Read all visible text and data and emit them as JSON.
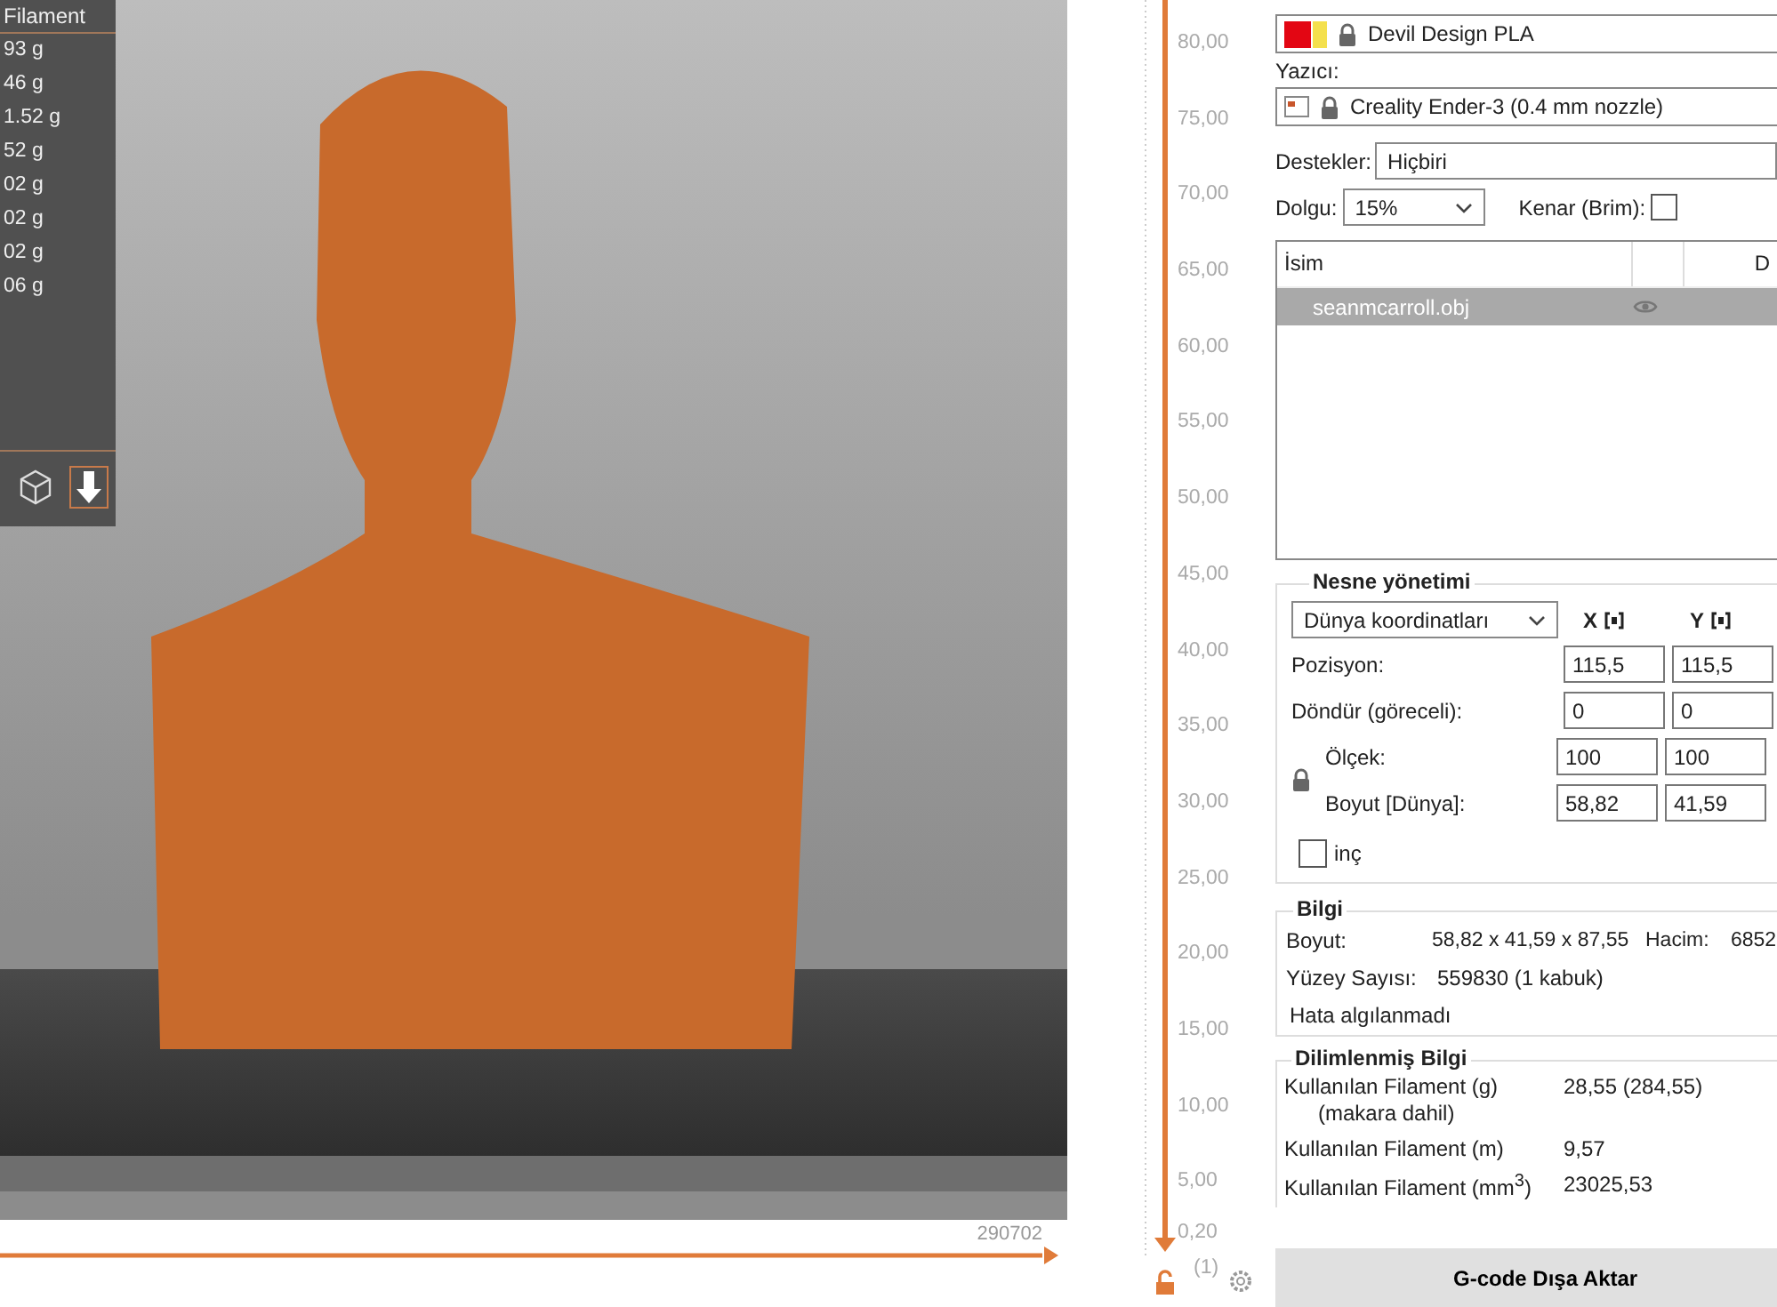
{
  "filament_panel": {
    "header": "Filament",
    "values": [
      "93 g",
      "46 g",
      "1.52 g",
      "52 g",
      "02 g",
      "02 g",
      "02 g",
      "06 g"
    ],
    "view_buttons": [
      {
        "kind": "cube",
        "selected": false
      },
      {
        "kind": "download",
        "selected": true
      }
    ]
  },
  "horizontal_slider": {
    "reading": "290702"
  },
  "vertical_ruler": {
    "labels": [
      "80,00",
      "75,00",
      "70,00",
      "65,00",
      "60,00",
      "55,00",
      "50,00",
      "45,00",
      "40,00",
      "35,00",
      "30,00",
      "25,00",
      "20,00",
      "15,00",
      "10,00",
      "5,00",
      "0,20"
    ],
    "layer": "(1)"
  },
  "sidebar": {
    "filament": {
      "value": "Devil Design PLA"
    },
    "printer": {
      "label": "Yazıcı:",
      "value": "Creality Ender-3 (0.4 mm nozzle)"
    },
    "supports": {
      "label": "Destekler:",
      "value": "Hiçbiri"
    },
    "infill": {
      "label": "Dolgu:",
      "value": "15%"
    },
    "brim": {
      "label": "Kenar (Brim):",
      "checked": false
    },
    "object_list": {
      "columns": [
        "İsim",
        "D"
      ],
      "rows": [
        {
          "name": "seanmcarroll.obj",
          "selected": true
        }
      ]
    },
    "object_manipulation": {
      "title": "Nesne yönetimi",
      "coordinates": "Dünya koordinatları",
      "axes": [
        "X",
        "Y"
      ],
      "rows": [
        {
          "label": "Pozisyon:",
          "values": [
            "115,5",
            "115,5"
          ]
        },
        {
          "label": "Döndür (göreceli):",
          "values": [
            "0",
            "0"
          ]
        }
      ],
      "scale_rows": [
        {
          "label": "Ölçek:",
          "values": [
            "100",
            "100"
          ]
        },
        {
          "label": "Boyut [Dünya]:",
          "values": [
            "58,82",
            "41,59"
          ]
        }
      ],
      "inches": {
        "label": "inç",
        "checked": false
      }
    },
    "info": {
      "title": "Bilgi",
      "size_label": "Boyut:",
      "size": "58,82 x 41,59 x 87,55",
      "volume_label": "Hacim:",
      "volume": "6852",
      "facets_label": "Yüzey Sayısı:",
      "facets": "559830 (1 kabuk)",
      "status": "Hata algılanmadı"
    },
    "sliced_info": {
      "title": "Dilimlenmiş Bilgi",
      "rows": [
        {
          "label": "Kullanılan Filament (g)",
          "sub": "(makara dahil)",
          "value": "28,55 (284,55)"
        },
        {
          "label": "Kullanılan Filament (m)",
          "value": "9,57"
        },
        {
          "label": "Kullanılan Filament (mm$^{3}$)",
          "value": "23025,53"
        }
      ]
    },
    "export_button": "G-code Dışa Aktar"
  }
}
